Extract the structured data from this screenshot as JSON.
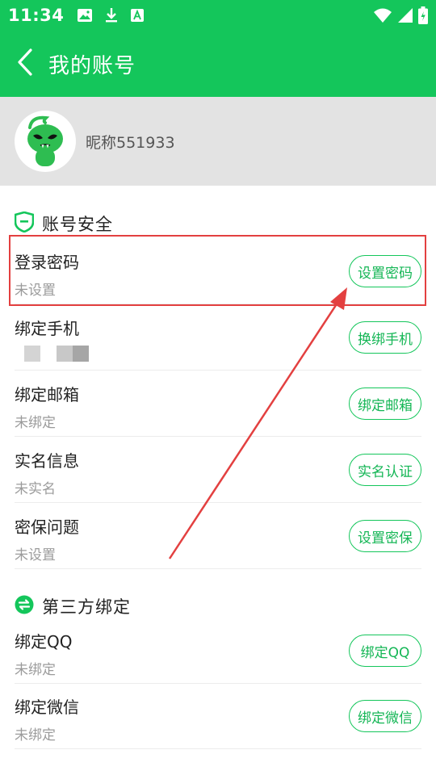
{
  "status_bar": {
    "time": "11:34"
  },
  "header": {
    "title": "我的账号"
  },
  "profile": {
    "nickname": "昵称551933"
  },
  "sections": {
    "security": {
      "title": "账号安全",
      "rows": [
        {
          "title": "登录密码",
          "subtitle": "未设置",
          "button": "设置密码"
        },
        {
          "title": "绑定手机",
          "subtitle": "",
          "button": "换绑手机"
        },
        {
          "title": "绑定邮箱",
          "subtitle": "未绑定",
          "button": "绑定邮箱"
        },
        {
          "title": "实名信息",
          "subtitle": "未实名",
          "button": "实名认证"
        },
        {
          "title": "密保问题",
          "subtitle": "未设置",
          "button": "设置密保"
        }
      ]
    },
    "third_party": {
      "title": "第三方绑定",
      "rows": [
        {
          "title": "绑定QQ",
          "subtitle": "未绑定",
          "button": "绑定QQ"
        },
        {
          "title": "绑定微信",
          "subtitle": "未绑定",
          "button": "绑定微信"
        }
      ]
    }
  },
  "icons": {
    "status_left": [
      "image-icon",
      "download-icon",
      "font-icon"
    ],
    "status_right": [
      "wifi-icon",
      "signal-icon",
      "battery-icon"
    ],
    "back": "back-arrow-icon",
    "avatar": "alien-avatar-icon",
    "security": "shield-icon",
    "third_party": "swap-circle-icon"
  },
  "colors": {
    "accent": "#14c65b",
    "annotation": "#e34040",
    "profile_bg": "#e3e3e3"
  }
}
